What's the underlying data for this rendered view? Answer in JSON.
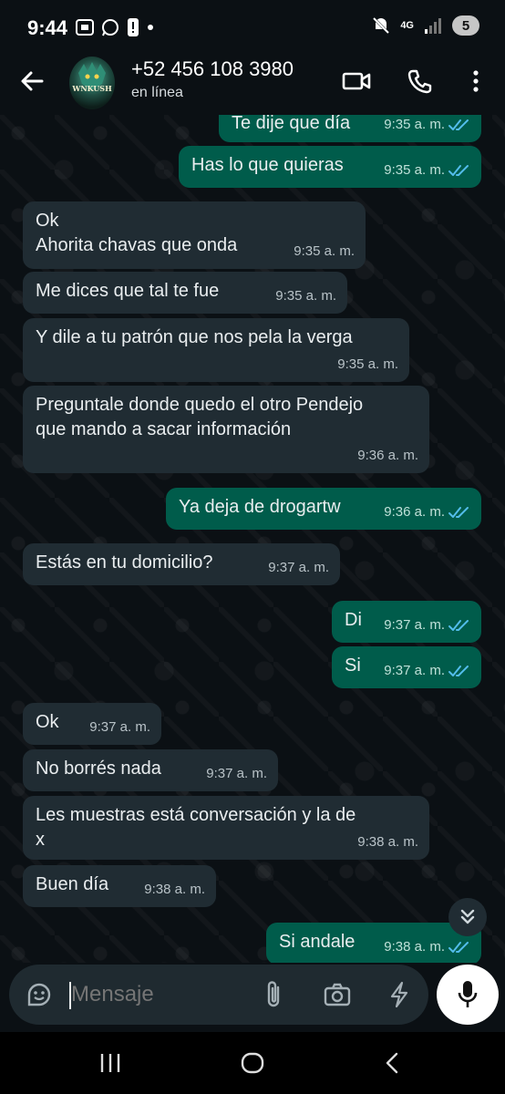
{
  "status_bar": {
    "time": "9:44",
    "network": "4G",
    "notification_count": "5"
  },
  "header": {
    "contact_name": "+52 456 108 3980",
    "status": "en línea",
    "avatar_text": "WNKUSH"
  },
  "messages": [
    {
      "dir": "out",
      "text": "Te dije que día",
      "time": "9:35 a. m.",
      "read": true
    },
    {
      "dir": "out",
      "text": "Has lo que quieras",
      "time": "9:35 a. m.",
      "read": true
    },
    {
      "dir": "in",
      "text": "Ok\nAhorita chavas que onda",
      "time": "9:35 a. m."
    },
    {
      "dir": "in",
      "text": "Me dices que tal te fue",
      "time": "9:35 a. m."
    },
    {
      "dir": "in",
      "text": "Y dile a tu patrón que nos pela la verga",
      "time": "9:35 a. m."
    },
    {
      "dir": "in",
      "text": "Preguntale donde quedo el otro Pendejo\nque mando a sacar información",
      "time": "9:36 a. m."
    },
    {
      "dir": "out",
      "text": "Ya deja de drogartw",
      "time": "9:36 a. m.",
      "read": true
    },
    {
      "dir": "in",
      "text": "Estás en tu domicilio?",
      "time": "9:37 a. m."
    },
    {
      "dir": "out",
      "text": "Di",
      "time": "9:37 a. m.",
      "read": true
    },
    {
      "dir": "out",
      "text": "Si",
      "time": "9:37 a. m.",
      "read": true
    },
    {
      "dir": "in",
      "text": "Ok",
      "time": "9:37 a. m."
    },
    {
      "dir": "in",
      "text": "No borrés nada",
      "time": "9:37 a. m."
    },
    {
      "dir": "in",
      "text": "Les muestras está conversación y la de\nx",
      "time": "9:38 a. m."
    },
    {
      "dir": "in",
      "text": "Buen día",
      "time": "9:38 a. m."
    },
    {
      "dir": "out",
      "text": "Si andale",
      "time": "9:38 a. m.",
      "read": true
    }
  ],
  "input": {
    "placeholder": "Mensaje"
  },
  "colors": {
    "background": "#0b1014",
    "incoming_bubble": "#202c33",
    "outgoing_bubble": "#005c4b",
    "read_ticks": "#53bdeb"
  }
}
